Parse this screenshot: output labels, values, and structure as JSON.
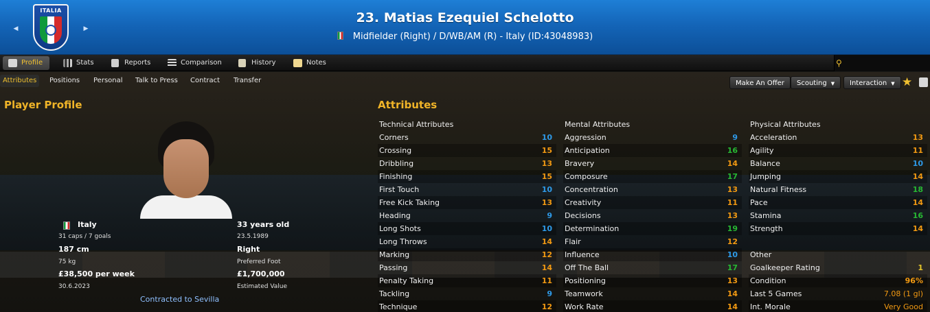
{
  "header": {
    "crest_label": "ITALIA",
    "title": "23. Matias Ezequiel Schelotto",
    "subtitle": "Midfielder (Right) / D/WB/AM (R) - Italy (ID:43048983)",
    "prev_arrow": "◀",
    "next_arrow": "▶"
  },
  "tabs": [
    {
      "label": "Profile"
    },
    {
      "label": "Stats"
    },
    {
      "label": "Reports"
    },
    {
      "label": "Comparison"
    },
    {
      "label": "History"
    },
    {
      "label": "Notes"
    }
  ],
  "subtabs": [
    "Attributes",
    "Positions",
    "Personal",
    "Talk to Press",
    "Contract",
    "Transfer"
  ],
  "actions": {
    "offer": "Make An Offer",
    "scouting": "Scouting",
    "interaction": "Interaction"
  },
  "profile": {
    "section_title": "Player Profile",
    "nationality": "Italy",
    "caps": "31 caps / 7 goals",
    "height": "187 cm",
    "weight": "75 kg",
    "wage": "£38,500 per week",
    "contract_end": "30.6.2023",
    "age": "33 years old",
    "dob": "23.5.1989",
    "foot": "Right",
    "foot_label": "Preferred Foot",
    "value": "£1,700,000",
    "value_label": "Estimated Value",
    "contracted": "Contracted to Sevilla"
  },
  "attributes": {
    "section_title": "Attributes",
    "technical_title": "Technical Attributes",
    "mental_title": "Mental Attributes",
    "physical_title": "Physical Attributes",
    "other_title": "Other",
    "technical": [
      {
        "name": "Corners",
        "value": "10"
      },
      {
        "name": "Crossing",
        "value": "15"
      },
      {
        "name": "Dribbling",
        "value": "13"
      },
      {
        "name": "Finishing",
        "value": "15"
      },
      {
        "name": "First Touch",
        "value": "10"
      },
      {
        "name": "Free Kick Taking",
        "value": "13"
      },
      {
        "name": "Heading",
        "value": "9"
      },
      {
        "name": "Long Shots",
        "value": "10"
      },
      {
        "name": "Long Throws",
        "value": "14"
      },
      {
        "name": "Marking",
        "value": "12"
      },
      {
        "name": "Passing",
        "value": "14"
      },
      {
        "name": "Penalty Taking",
        "value": "11"
      },
      {
        "name": "Tackling",
        "value": "9"
      },
      {
        "name": "Technique",
        "value": "12"
      }
    ],
    "mental": [
      {
        "name": "Aggression",
        "value": "9"
      },
      {
        "name": "Anticipation",
        "value": "16"
      },
      {
        "name": "Bravery",
        "value": "14"
      },
      {
        "name": "Composure",
        "value": "17"
      },
      {
        "name": "Concentration",
        "value": "13"
      },
      {
        "name": "Creativity",
        "value": "11"
      },
      {
        "name": "Decisions",
        "value": "13"
      },
      {
        "name": "Determination",
        "value": "19"
      },
      {
        "name": "Flair",
        "value": "12"
      },
      {
        "name": "Influence",
        "value": "10"
      },
      {
        "name": "Off The Ball",
        "value": "17"
      },
      {
        "name": "Positioning",
        "value": "13"
      },
      {
        "name": "Teamwork",
        "value": "14"
      },
      {
        "name": "Work Rate",
        "value": "14"
      }
    ],
    "physical": [
      {
        "name": "Acceleration",
        "value": "13"
      },
      {
        "name": "Agility",
        "value": "11"
      },
      {
        "name": "Balance",
        "value": "10"
      },
      {
        "name": "Jumping",
        "value": "14"
      },
      {
        "name": "Natural Fitness",
        "value": "18"
      },
      {
        "name": "Pace",
        "value": "14"
      },
      {
        "name": "Stamina",
        "value": "16"
      },
      {
        "name": "Strength",
        "value": "14"
      }
    ],
    "other": [
      {
        "name": "Goalkeeper Rating",
        "value": "1"
      },
      {
        "name": "Condition",
        "value": "96%"
      },
      {
        "name": "Last 5 Games",
        "value": "7.08 (1 gl)"
      },
      {
        "name": "Int. Morale",
        "value": "Very Good"
      }
    ]
  },
  "colors": {
    "header_blue": "#1465b8",
    "accent_gold": "#f0b428",
    "low": "#2e9ae8",
    "mid": "#f39a12",
    "high": "#27b833"
  }
}
